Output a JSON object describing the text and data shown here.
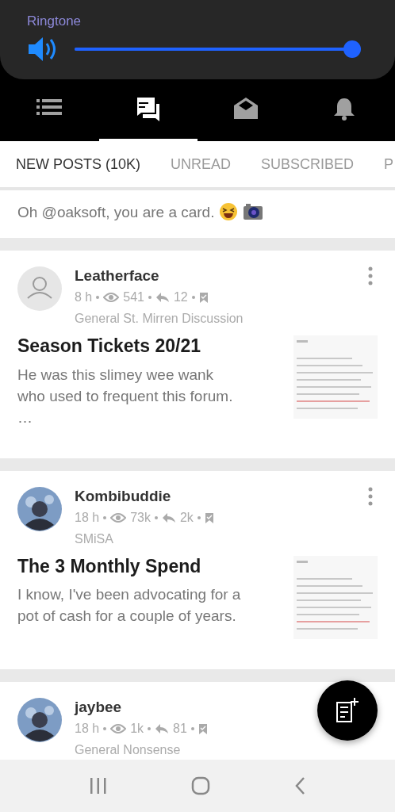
{
  "volume_panel": {
    "label": "Ringtone",
    "level": 0.98
  },
  "section_tabs": [
    {
      "kind": "list",
      "selected": false
    },
    {
      "kind": "chats",
      "selected": true
    },
    {
      "kind": "mail",
      "selected": false
    },
    {
      "kind": "bell",
      "selected": false
    }
  ],
  "tabs": [
    {
      "label": "NEW POSTS (10K)",
      "selected": true
    },
    {
      "label": "UNREAD",
      "selected": false
    },
    {
      "label": "SUBSCRIBED",
      "selected": false
    },
    {
      "label": "P",
      "selected": false
    }
  ],
  "partial_post": {
    "excerpt": "Oh @oaksoft, you are a card."
  },
  "posts": [
    {
      "avatar": {
        "kind": "icon"
      },
      "author": "Leatherface",
      "time": "8 h",
      "views": "541",
      "replies": "12",
      "forum": "General St. Mirren Discussion",
      "title": "Season Tickets 20/21",
      "excerpt": "He was this slimey wee wank who used to frequent this forum. …"
    },
    {
      "author": "Kombibuddie",
      "time": "18 h",
      "views": "73k",
      "replies": "2k",
      "forum": "SMiSA",
      "title": "The 3 Monthly Spend",
      "excerpt": "I know, I've been advocating for a pot of cash for a couple of years."
    },
    {
      "author": "jaybee",
      "time": "18 h",
      "views": "1k",
      "replies": "81",
      "forum": "General Nonsense"
    }
  ]
}
